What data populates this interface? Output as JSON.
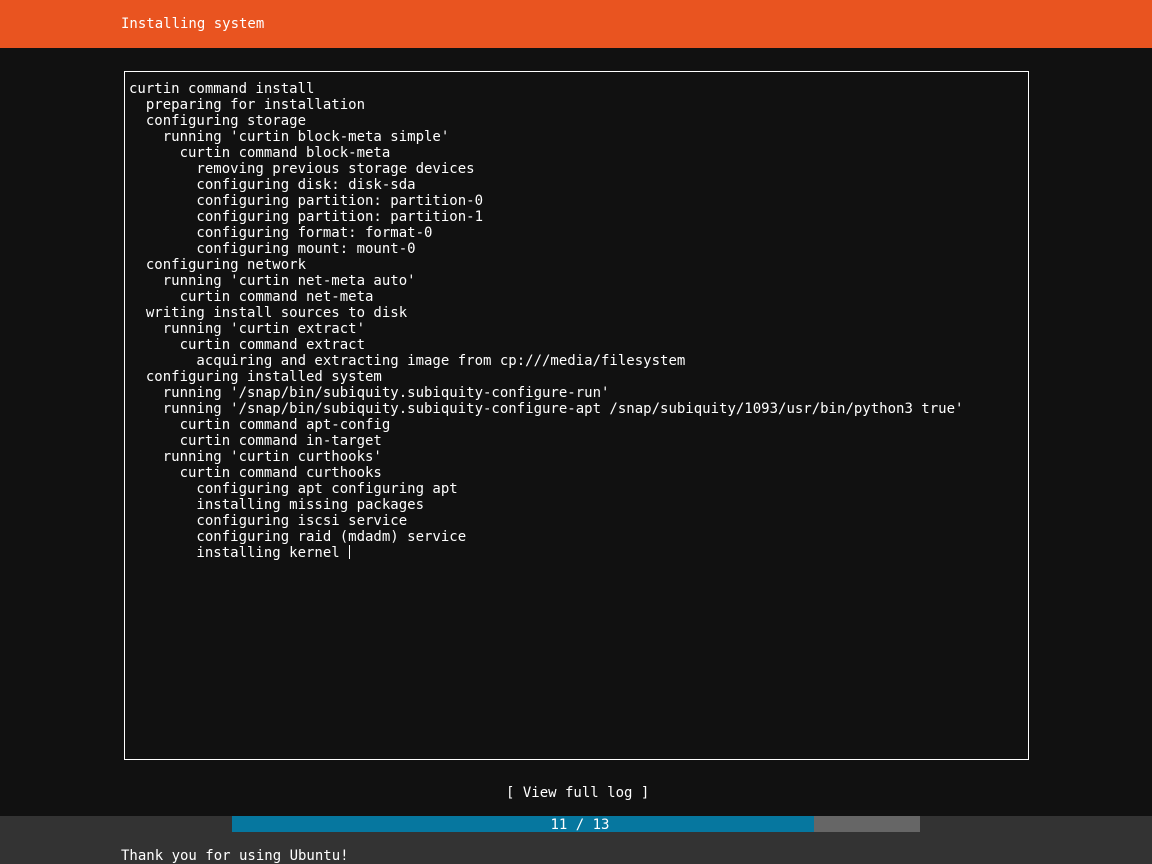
{
  "header": {
    "title": "Installing system",
    "color": "#e95420"
  },
  "log": {
    "lines": [
      "curtin command install",
      "  preparing for installation",
      "  configuring storage",
      "    running 'curtin block-meta simple'",
      "      curtin command block-meta",
      "        removing previous storage devices",
      "        configuring disk: disk-sda",
      "        configuring partition: partition-0",
      "        configuring partition: partition-1",
      "        configuring format: format-0",
      "        configuring mount: mount-0",
      "  configuring network",
      "    running 'curtin net-meta auto'",
      "      curtin command net-meta",
      "  writing install sources to disk",
      "    running 'curtin extract'",
      "      curtin command extract",
      "        acquiring and extracting image from cp:///media/filesystem",
      "  configuring installed system",
      "    running '/snap/bin/subiquity.subiquity-configure-run'",
      "    running '/snap/bin/subiquity.subiquity-configure-apt /snap/subiquity/1093/usr/bin/python3 true'",
      "      curtin command apt-config",
      "      curtin command in-target",
      "    running 'curtin curthooks'",
      "      curtin command curthooks",
      "        configuring apt configuring apt",
      "        installing missing packages",
      "        configuring iscsi service",
      "        configuring raid (mdadm) service",
      "        installing kernel"
    ]
  },
  "actions": {
    "view_full_log": "[ View full log ]"
  },
  "progress": {
    "current": 11,
    "total": 13,
    "label": "11 / 13",
    "fill_color": "#06779f",
    "track_color": "#666666"
  },
  "footer": {
    "message": "Thank you for using Ubuntu!"
  }
}
